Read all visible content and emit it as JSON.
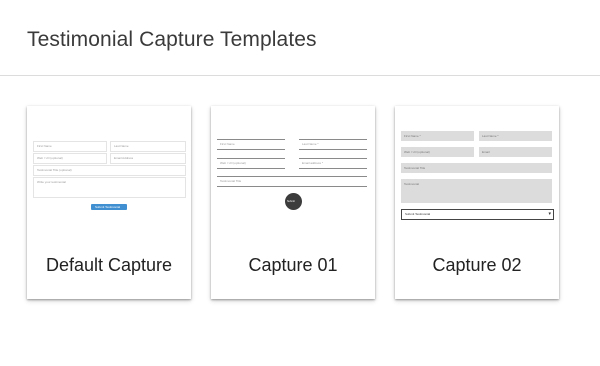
{
  "page": {
    "title": "Testimonial Capture Templates"
  },
  "templates": [
    {
      "name": "Default Capture",
      "fields": [
        "First Name",
        "Last Name",
        "Web / Url (optional)",
        "Email Address",
        "Testimonial Title (optional)",
        "Write your testimonial"
      ],
      "button": "Submit Testimonial"
    },
    {
      "name": "Capture 01",
      "fields": [
        "First Name",
        "Last Name *",
        "Web / Url (optional)",
        "Email address *",
        "Testimonial Title"
      ],
      "button": "Submit"
    },
    {
      "name": "Capture 02",
      "fields": [
        "First Name *",
        "Last Name *",
        "Web / Url (optional)",
        "Email",
        "Testimonial Title",
        "Testimonial"
      ],
      "button": "Submit Testimonial"
    }
  ]
}
